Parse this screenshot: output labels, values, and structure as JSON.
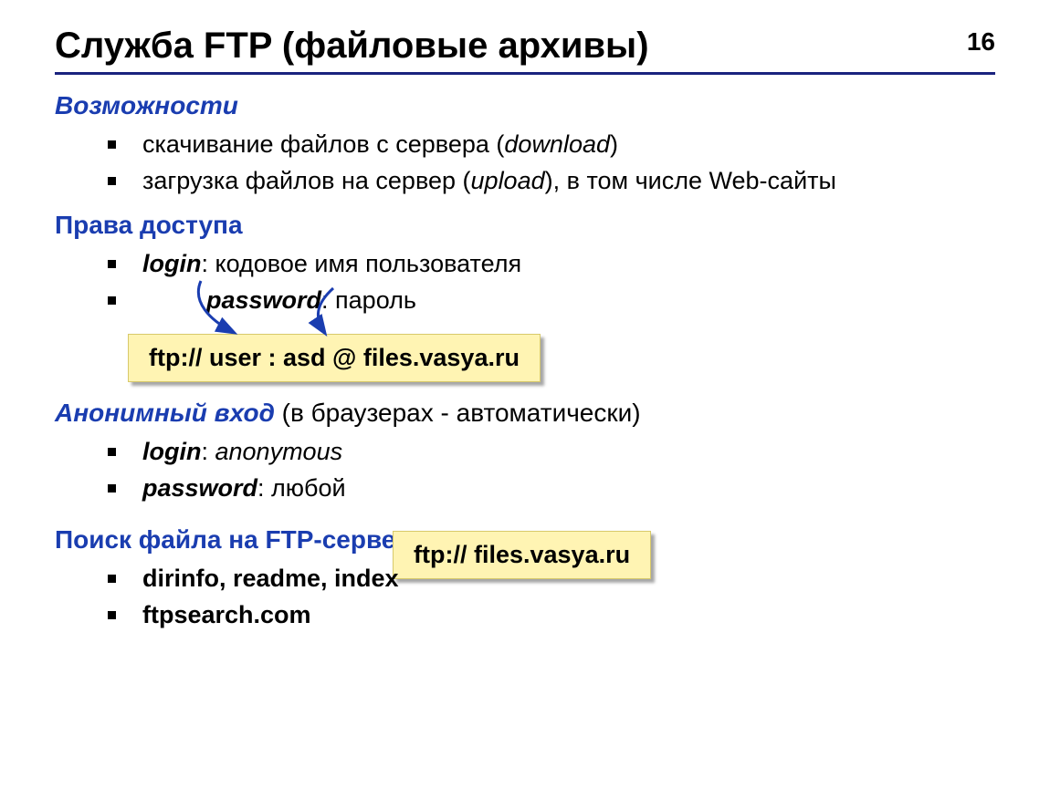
{
  "page_number": "16",
  "title": "Служба FTP (файловые архивы)",
  "sections": {
    "capabilities": {
      "heading": "Возможности",
      "item1_pre": "скачивание файлов c сервера (",
      "item1_em": "download",
      "item1_post": ")",
      "item2_pre": "загрузка файлов на сервер (",
      "item2_em": "upload",
      "item2_post": "), в том числе Web-сайты"
    },
    "access": {
      "heading": "Права доступа",
      "item1_term": "login",
      "item1_desc": ": кодовое имя пользователя",
      "item2_term": "password",
      "item2_desc": ": пароль",
      "example": "ftp:// user : asd @ files.vasya.ru"
    },
    "anon": {
      "heading": "Анонимный вход",
      "heading_tail": " (в браузерах - автоматически)",
      "item1_term": "login",
      "item1_value": "anonymous",
      "item2_term": "password",
      "item2_value": ": любой",
      "example": "ftp:// files.vasya.ru"
    },
    "search": {
      "heading": "Поиск файла на FTP-сервере",
      "item1": "dirinfo, readme, index",
      "item2": "ftpsearch.com"
    }
  }
}
